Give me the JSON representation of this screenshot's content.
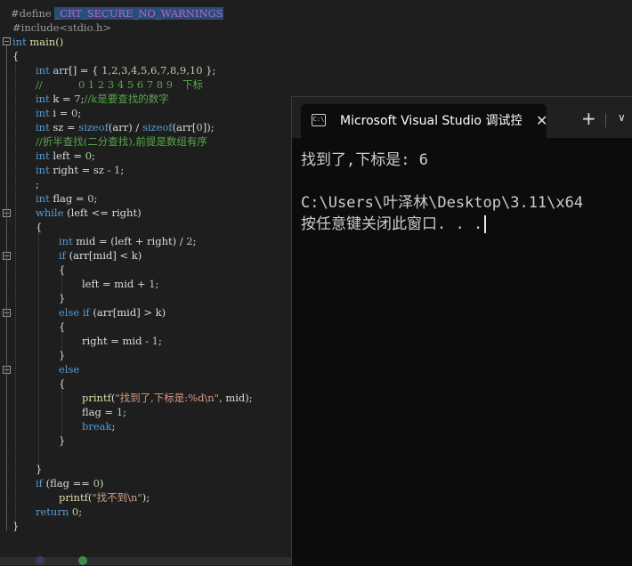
{
  "editor": {
    "code": {
      "l1_a": "#define",
      "l1_b": "_CRT_SECURE_NO_WARNINGS",
      "l2": "#include<stdio.h>",
      "l3_a": "int",
      "l3_b": " main()",
      "l4": "{",
      "l5_a": "int",
      "l5_b": " arr",
      "l5_c": "[] = { ",
      "l5_d": "1,2,3,4,5,6,7,8,9,10",
      "l5_e": " };",
      "l6": "//           0 1 2 3 4 5 6 7 8 9   下标",
      "l7_a": "int",
      "l7_b": " k = ",
      "l7_c": "7",
      "l7_d": ";",
      "l7_e": "//k是要查找的数字",
      "l8_a": "int",
      "l8_b": " i = ",
      "l8_c": "0",
      "l8_d": ";",
      "l9_a": "int",
      "l9_b": " sz = ",
      "l9_c": "sizeof",
      "l9_d": "(arr) / ",
      "l9_e": "sizeof",
      "l9_f": "(arr[",
      "l9_g": "0",
      "l9_h": "]);",
      "l10": "//折半查找(二分查找),前提是数组有序",
      "l11_a": "int",
      "l11_b": " left = ",
      "l11_c": "0",
      "l11_d": ";",
      "l12_a": "int",
      "l12_b": " right = sz - ",
      "l12_c": "1",
      "l12_d": ";",
      "l13": ";",
      "l14_a": "int",
      "l14_b": " flag = ",
      "l14_c": "0",
      "l14_d": ";",
      "l15_a": "while",
      "l15_b": " (left <= right)",
      "l16": "{",
      "l17_a": "int",
      "l17_b": " mid = (left + right) / ",
      "l17_c": "2",
      "l17_d": ";",
      "l18_a": "if",
      "l18_b": " (arr[mid] < k)",
      "l19": "{",
      "l20_a": "left = mid + ",
      "l20_b": "1",
      "l20_c": ";",
      "l21": "}",
      "l22_a": "else if",
      "l22_b": " (arr[mid] > k)",
      "l23": "{",
      "l24_a": "right = mid - ",
      "l24_b": "1",
      "l24_c": ";",
      "l25": "}",
      "l26": "else",
      "l27": "{",
      "l28_a": "printf",
      "l28_b": "(",
      "l28_c": "\"找到了,下标是:%d\\n\"",
      "l28_d": ", mid);",
      "l29_a": "flag = ",
      "l29_b": "1",
      "l29_c": ";",
      "l30_a": "break",
      "l30_b": ";",
      "l31": "}",
      "l32": "}",
      "l33_a": "if",
      "l33_b": " (flag == ",
      "l33_c": "0",
      "l33_d": ")",
      "l34_a": "printf",
      "l34_b": "(",
      "l34_c": "\"找不到\\n\"",
      "l34_d": ");",
      "l35_a": "return",
      "l35_b": " ",
      "l35_c": "0",
      "l35_d": ";",
      "l36": "}"
    }
  },
  "terminal": {
    "tab_title": "Microsoft Visual Studio 调试控制台",
    "tab_icon_glyph": "C:\\",
    "close_glyph": "✕",
    "new_tab_glyph": "+",
    "dropdown_glyph": "∨",
    "output": {
      "line1": "找到了,下标是: 6",
      "line2": "",
      "line3": "C:\\Users\\叶泽林\\Desktop\\3.11\\x64",
      "line4": "按任意键关闭此窗口. . ."
    }
  },
  "colors": {
    "keyword": "#569cd6",
    "comment": "#57a64a",
    "string": "#d69d85",
    "number": "#b5cea8",
    "function": "#dcdcaa",
    "macro": "#bd63c5",
    "editor_bg": "#1e1e1e",
    "terminal_bg": "#0c0c0c",
    "titlebar_bg": "#202020"
  }
}
